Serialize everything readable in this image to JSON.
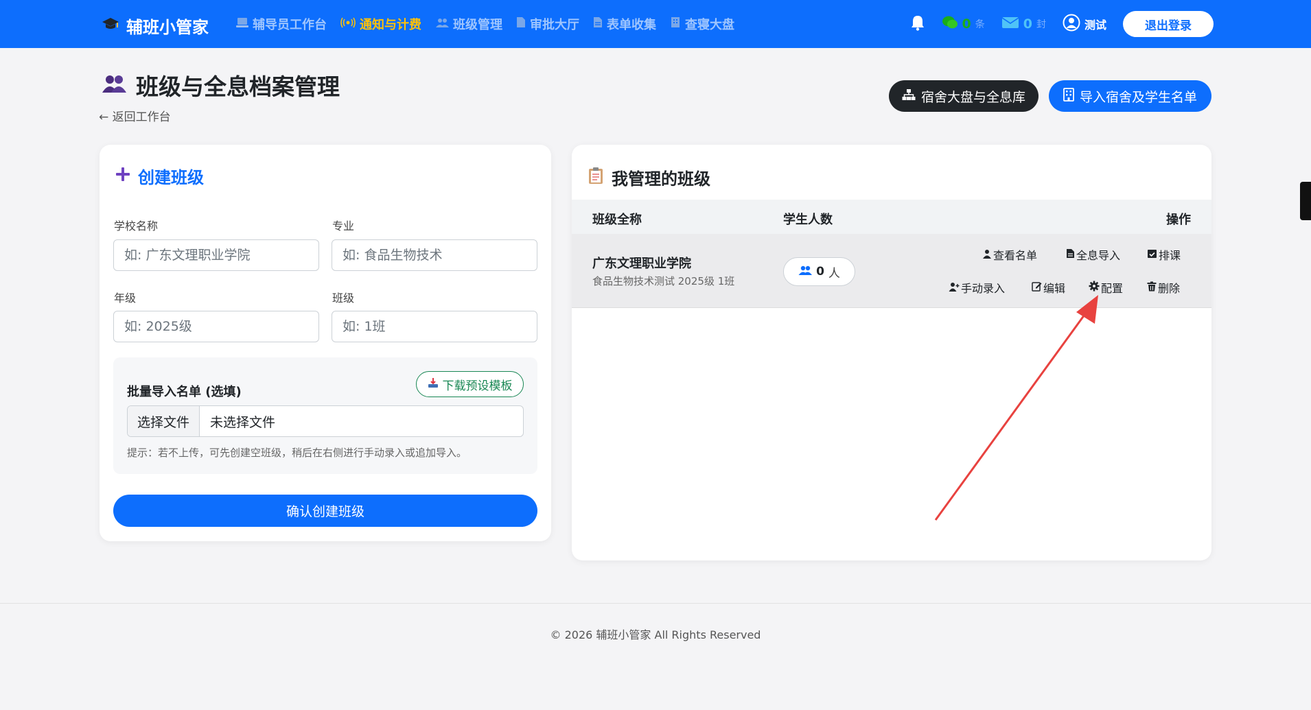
{
  "navbar": {
    "brand": "辅班小管家",
    "menu": [
      {
        "label": "辅导员工作台",
        "icon": "laptop-icon"
      },
      {
        "label": "通知与计费",
        "icon": "broadcast-icon"
      },
      {
        "label": "班级管理",
        "icon": "group-icon"
      },
      {
        "label": "审批大厅",
        "icon": "document-icon"
      },
      {
        "label": "表单收集",
        "icon": "form-icon"
      },
      {
        "label": "查寝大盘",
        "icon": "building-icon"
      }
    ],
    "active_menu": "通知与计费",
    "wechat_count": "0",
    "wechat_unit": "条",
    "mail_count": "0",
    "mail_unit": "封",
    "user_name": "测试",
    "logout_label": "退出登录"
  },
  "header": {
    "title": "班级与全息档案管理",
    "back_link": "← 返回工作台",
    "dorm_button": "宿舍大盘与全息库",
    "import_button": "导入宿舍及学生名单"
  },
  "create_form": {
    "title": "创建班级",
    "school_label": "学校名称",
    "school_placeholder": "如: 广东文理职业学院",
    "major_label": "专业",
    "major_placeholder": "如: 食品生物技术",
    "grade_label": "年级",
    "grade_placeholder": "如: 2025级",
    "class_label": "班级",
    "class_placeholder": "如: 1班",
    "import_title": "批量导入名单 (选填)",
    "template_button": "下载预设模板",
    "file_button": "选择文件",
    "file_status": "未选择文件",
    "hint": "提示：若不上传，可先创建空班级，稍后在右侧进行手动录入或追加导入。",
    "submit": "确认创建班级"
  },
  "class_list": {
    "title": "我管理的班级",
    "columns": [
      "班级全称",
      "学生人数",
      "操作"
    ],
    "rows": [
      {
        "school": "广东文理职业学院",
        "detail": "食品生物技术测试 2025级 1班",
        "count": "0",
        "count_unit": "人",
        "actions": [
          "查看名单",
          "全息导入",
          "排课",
          "手动录入",
          "编辑",
          "配置",
          "删除"
        ]
      }
    ]
  },
  "footer": {
    "copyright": "© 2026 辅班小管家 All Rights Reserved"
  },
  "colors": {
    "primary": "#0d6efd",
    "active_nav": "#ffc107",
    "dark_button": "#212529",
    "template_green": "#198754",
    "annotation_arrow": "#e8423f"
  }
}
